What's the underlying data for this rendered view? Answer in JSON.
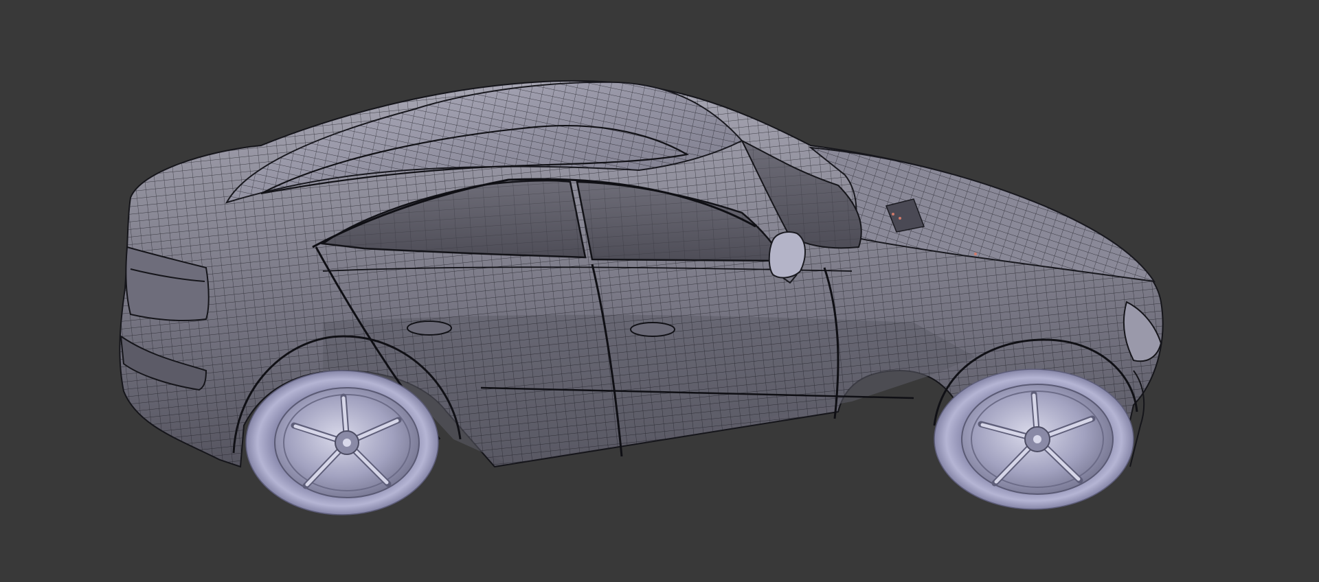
{
  "viewport": {
    "background": "#393939",
    "object": "car-mesh",
    "shading": "solid-with-wireframe",
    "colors": {
      "mesh_body": "#7c7b8a",
      "mesh_highlight": "#c8c8d6",
      "wire": "#1c1c22",
      "wheel": "#a9a9c6",
      "wheel_dark": "#6b6b86",
      "glass": "#5c5b66"
    }
  }
}
